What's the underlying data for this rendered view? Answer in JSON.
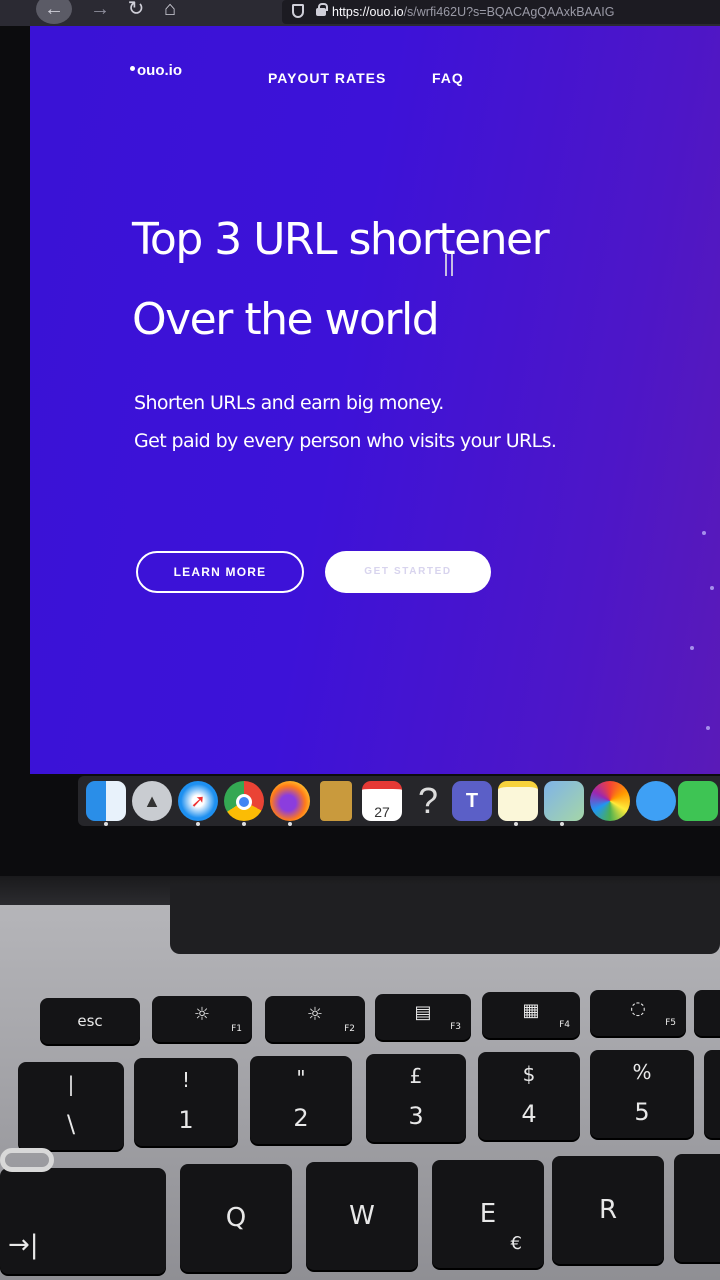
{
  "browser": {
    "url_host": "https://ouo.io",
    "url_rest": "/s/wrfi462U?s=BQACAgQAAxkBAAIG",
    "icons": [
      "back-arrow-icon",
      "forward-arrow-icon",
      "reload-icon",
      "home-icon",
      "shield-icon",
      "lock-icon"
    ]
  },
  "page": {
    "logo": "ouo.io",
    "nav": {
      "payout": "PAYOUT RATES",
      "faq": "FAQ"
    },
    "title_line1": "Top 3 URL shortener",
    "title_line2": "Over the world",
    "subtitle_line1": "Shorten URLs and earn big money.",
    "subtitle_line2": "Get paid by every person who visits your URLs.",
    "learn_more": "LEARN MORE",
    "get_started": "GET STARTED",
    "colors": {
      "background": "#3d12d8",
      "text": "#ffffff"
    }
  },
  "dock": {
    "icons": [
      "finder-icon",
      "launchpad-icon",
      "safari-icon",
      "chrome-icon",
      "firefox-icon",
      "contacts-icon",
      "calendar-icon",
      "help-icon",
      "teams-icon",
      "notes-icon",
      "preview-icon",
      "photos-icon",
      "messages-icon",
      "facetime-icon"
    ],
    "calendar_day": "27",
    "help_glyph": "?",
    "teams_glyph": "T"
  },
  "keyboard": {
    "esc": "esc",
    "f1": "F1",
    "f2": "F2",
    "f3": "F3",
    "f4": "F4",
    "f5": "F5",
    "k_backslash_top": "|",
    "k_backslash_bottom": "\\",
    "k1_top": "!",
    "k1_bottom": "1",
    "k2_top": "\"",
    "k2_bottom": "2",
    "k3_top": "£",
    "k3_bottom": "3",
    "k4_top": "$",
    "k4_bottom": "4",
    "k5_top": "%",
    "k5_bottom": "5",
    "tab": "→|",
    "q": "Q",
    "w": "W",
    "e": "E",
    "e_alt": "€",
    "r": "R"
  }
}
